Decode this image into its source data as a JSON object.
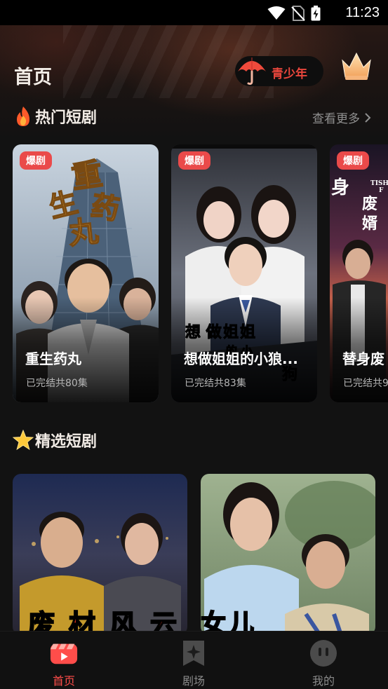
{
  "status_bar": {
    "time": "11:23"
  },
  "header": {
    "title": "首页",
    "youth_mode_label": "青少年"
  },
  "hot_section": {
    "title": "热门短剧",
    "more_label": "查看更多",
    "cards": [
      {
        "badge": "爆剧",
        "title": "重生药丸",
        "subtitle": "已完结共80集",
        "poster_text": "重生药丸"
      },
      {
        "badge": "爆剧",
        "title": "想做姐姐的小狼...",
        "subtitle": "已完结共83集",
        "poster_text": "想做姐姐的小狼狗"
      },
      {
        "badge": "爆剧",
        "title": "替身废",
        "subtitle": "已完结共9",
        "poster_text": "替身废婿"
      }
    ]
  },
  "featured_section": {
    "title": "精选短剧",
    "cards": [
      {
        "poster_text": "废材风云"
      },
      {
        "poster_text": "女儿"
      }
    ]
  },
  "tab_bar": {
    "tabs": [
      {
        "label": "首页",
        "icon": "clapperboard-icon",
        "active": true
      },
      {
        "label": "剧场",
        "icon": "sparkle-icon",
        "active": false
      },
      {
        "label": "我的",
        "icon": "profile-face-icon",
        "active": false
      }
    ]
  },
  "colors": {
    "accent": "#ff4d4a",
    "badge": "#ea4a4a",
    "background": "#121212"
  }
}
